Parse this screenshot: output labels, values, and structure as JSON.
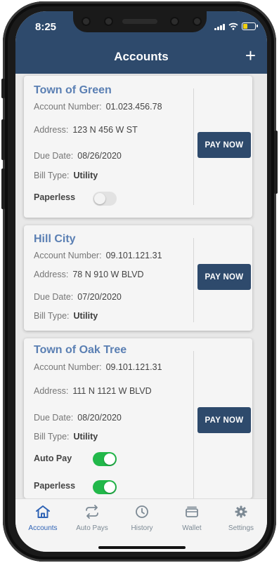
{
  "status_bar": {
    "time": "8:25"
  },
  "header": {
    "title": "Accounts",
    "add_label": "+"
  },
  "labels": {
    "account_number": "Account Number:",
    "address": "Address:",
    "due_date": "Due Date:",
    "bill_type": "Bill Type:",
    "pay_now": "PAY NOW",
    "auto_pay": "Auto Pay",
    "paperless": "Paperless"
  },
  "accounts": [
    {
      "name": "Town of Green",
      "account_number": "01.023.456.78",
      "address": "123 N 456 W ST",
      "due_date": "08/26/2020",
      "bill_type": "Utility",
      "paperless": false
    },
    {
      "name": "Hill City",
      "account_number": "09.101.121.31",
      "address": "78 N 910 W BLVD",
      "due_date": "07/20/2020",
      "bill_type": "Utility"
    },
    {
      "name": "Town of Oak Tree",
      "account_number": "09.101.121.31",
      "address": "111 N 1121 W BLVD",
      "due_date": "08/20/2020",
      "bill_type": "Utility",
      "auto_pay": true,
      "paperless": true
    }
  ],
  "tabs": [
    {
      "label": "Accounts",
      "icon": "home-icon",
      "active": true
    },
    {
      "label": "Auto Pays",
      "icon": "repeat-icon",
      "active": false
    },
    {
      "label": "History",
      "icon": "clock-icon",
      "active": false
    },
    {
      "label": "Wallet",
      "icon": "wallet-icon",
      "active": false
    },
    {
      "label": "Settings",
      "icon": "gear-icon",
      "active": false
    }
  ],
  "colors": {
    "brand": "#2e4a6c",
    "account_name": "#5a7fb3",
    "toggle_on": "#22b84a",
    "tab_active": "#2f63b5",
    "tab_inactive": "#7d8a95",
    "battery": "#f2d00f"
  }
}
